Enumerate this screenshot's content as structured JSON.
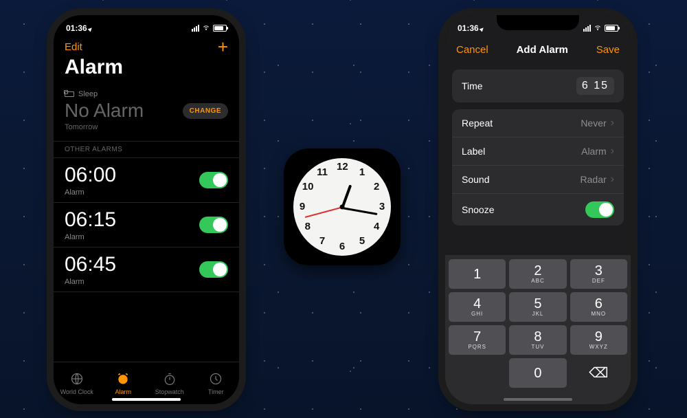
{
  "status": {
    "time": "01:36",
    "location_icon": "▴"
  },
  "left": {
    "edit": "Edit",
    "add": "+",
    "title": "Alarm",
    "sleep_section": "Sleep",
    "no_alarm": "No Alarm",
    "change": "CHANGE",
    "tomorrow": "Tomorrow",
    "other_header": "OTHER ALARMS",
    "alarms": [
      {
        "time": "06:00",
        "label": "Alarm",
        "on": true
      },
      {
        "time": "06:15",
        "label": "Alarm",
        "on": true
      },
      {
        "time": "06:45",
        "label": "Alarm",
        "on": true
      }
    ],
    "tabs": [
      {
        "label": "World Clock"
      },
      {
        "label": "Alarm"
      },
      {
        "label": "Stopwatch"
      },
      {
        "label": "Timer"
      }
    ]
  },
  "right": {
    "cancel": "Cancel",
    "title": "Add Alarm",
    "save": "Save",
    "time_label": "Time",
    "time_value": "6 15",
    "rows": {
      "repeat_label": "Repeat",
      "repeat_value": "Never",
      "label_label": "Label",
      "label_value": "Alarm",
      "sound_label": "Sound",
      "sound_value": "Radar",
      "snooze_label": "Snooze"
    },
    "keys": [
      {
        "n": "1",
        "l": ""
      },
      {
        "n": "2",
        "l": "ABC"
      },
      {
        "n": "3",
        "l": "DEF"
      },
      {
        "n": "4",
        "l": "GHI"
      },
      {
        "n": "5",
        "l": "JKL"
      },
      {
        "n": "6",
        "l": "MNO"
      },
      {
        "n": "7",
        "l": "PQRS"
      },
      {
        "n": "8",
        "l": "TUV"
      },
      {
        "n": "9",
        "l": "WXYZ"
      },
      {
        "n": "",
        "l": ""
      },
      {
        "n": "0",
        "l": ""
      },
      {
        "n": "⌫",
        "l": ""
      }
    ]
  },
  "clock": {
    "numbers": [
      "12",
      "1",
      "2",
      "3",
      "4",
      "5",
      "6",
      "7",
      "8",
      "9",
      "10",
      "11"
    ],
    "hour_angle": 20,
    "minute_angle": 100,
    "second_angle": 255
  }
}
